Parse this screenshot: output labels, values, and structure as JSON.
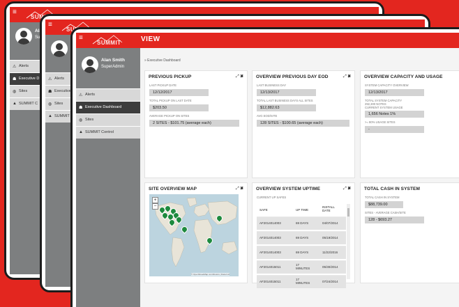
{
  "app": {
    "logo_text": "SUMMIT",
    "view_title": "VIEW",
    "hamburger": "≡"
  },
  "user": {
    "name": "Alan Smith",
    "role": "SuperAdmin",
    "name_back1": "Ala",
    "role_back1": "Sup",
    "name_back2": "Al",
    "role_back2": "Su"
  },
  "nav": {
    "items": [
      {
        "label": "Alerts",
        "icon": "alert-icon",
        "glyph": "⚠"
      },
      {
        "label": "Executive Dashboard",
        "icon": "dashboard-icon",
        "glyph": "☗"
      },
      {
        "label": "Sites",
        "icon": "globe-icon",
        "glyph": "◍"
      },
      {
        "label": "SUMMIT Control",
        "icon": "summit-icon",
        "glyph": "▲"
      }
    ],
    "back1_labels": [
      "Alerts",
      "Executive D",
      "Sites",
      "SUMMIT C"
    ],
    "back2_labels": [
      "Alerts",
      "Executive",
      "Sites",
      "SUMMIT C"
    ]
  },
  "breadcrumb": "» Executive Dashboard",
  "controls": {
    "expand": "⤢",
    "close": "✖"
  },
  "cards": {
    "pickup": {
      "title": "PREVIOUS PICKUP",
      "last_pickup_label": "LAST PICKUP DATE",
      "last_pickup_value": "12/12/2017",
      "total_label": "TOTAL PICKUP ON LAST DATE",
      "total_value": "$203.50",
      "avg_label": "AVERAGE PICKUP ON SITES",
      "avg_value": "2 SITES - $101.75 (average each)"
    },
    "eod": {
      "title": "OVERVIEW PREVIOUS DAY EOD",
      "last_business_label": "LAST BUSINESS DAY",
      "last_business_value": "12/13/2017",
      "total_label": "TOTAL LAST BUSINESS DAYS ALL SITES",
      "total_value": "$12,882.63",
      "avg_label": "AVG EOD/SITE",
      "avg_value": "128 SITES - $100.65 (average each)"
    },
    "capacity": {
      "title": "OVERVIEW CAPACITY AND USAGE",
      "overview_label": "SYSTEM CAPACITY OVERVIEW",
      "overview_value": "12/13/2017",
      "total_label_1": "TOTAL SYSTEM CAPACITY",
      "total_label_2": "292,300 NOTES",
      "total_label_3": "CURRENT SYSTEM USAGE",
      "usage_value": "1,656 Notes 1%",
      "sites_label": ">= 80% USAGE SITES",
      "sites_value": "-"
    },
    "map": {
      "title": "SITE OVERVIEW MAP",
      "attribution": "© OpenStreetMap contributors | Data Incl",
      "zoom_in": "+",
      "zoom_out": "−"
    },
    "uptime": {
      "title": "OVERVIEW SYSTEM UPTIME",
      "subtitle": "CURRENT UP SAFES",
      "columns": [
        "SAFE",
        "UP TIME",
        "INSTALL DATE"
      ],
      "rows": [
        [
          "AF2014014003",
          "69 DAYS",
          "04/07/2014"
        ],
        [
          "AF2014014003",
          "69 DAYS",
          "05/19/2014"
        ],
        [
          "AF2014014003",
          "69 DAYS",
          "11/22/2016"
        ],
        [
          "AF2014015011",
          "17 MINUTES",
          "05/30/2014"
        ],
        [
          "AF2014015011",
          "17 MINUTES",
          "07/24/2014"
        ]
      ]
    },
    "cash": {
      "title": "TOTAL CASH IN SYSTEM",
      "total_label": "TOTAL CASH IN SYSTEM",
      "total_value": "$88,739.00",
      "avg_label": "SITES - AVERAGE CASH/SITE",
      "avg_value": "128 - $693.27"
    }
  },
  "colors": {
    "brand": "#e3261f",
    "sidebar": "#7d7f80",
    "marker": "#1e8a3e"
  }
}
